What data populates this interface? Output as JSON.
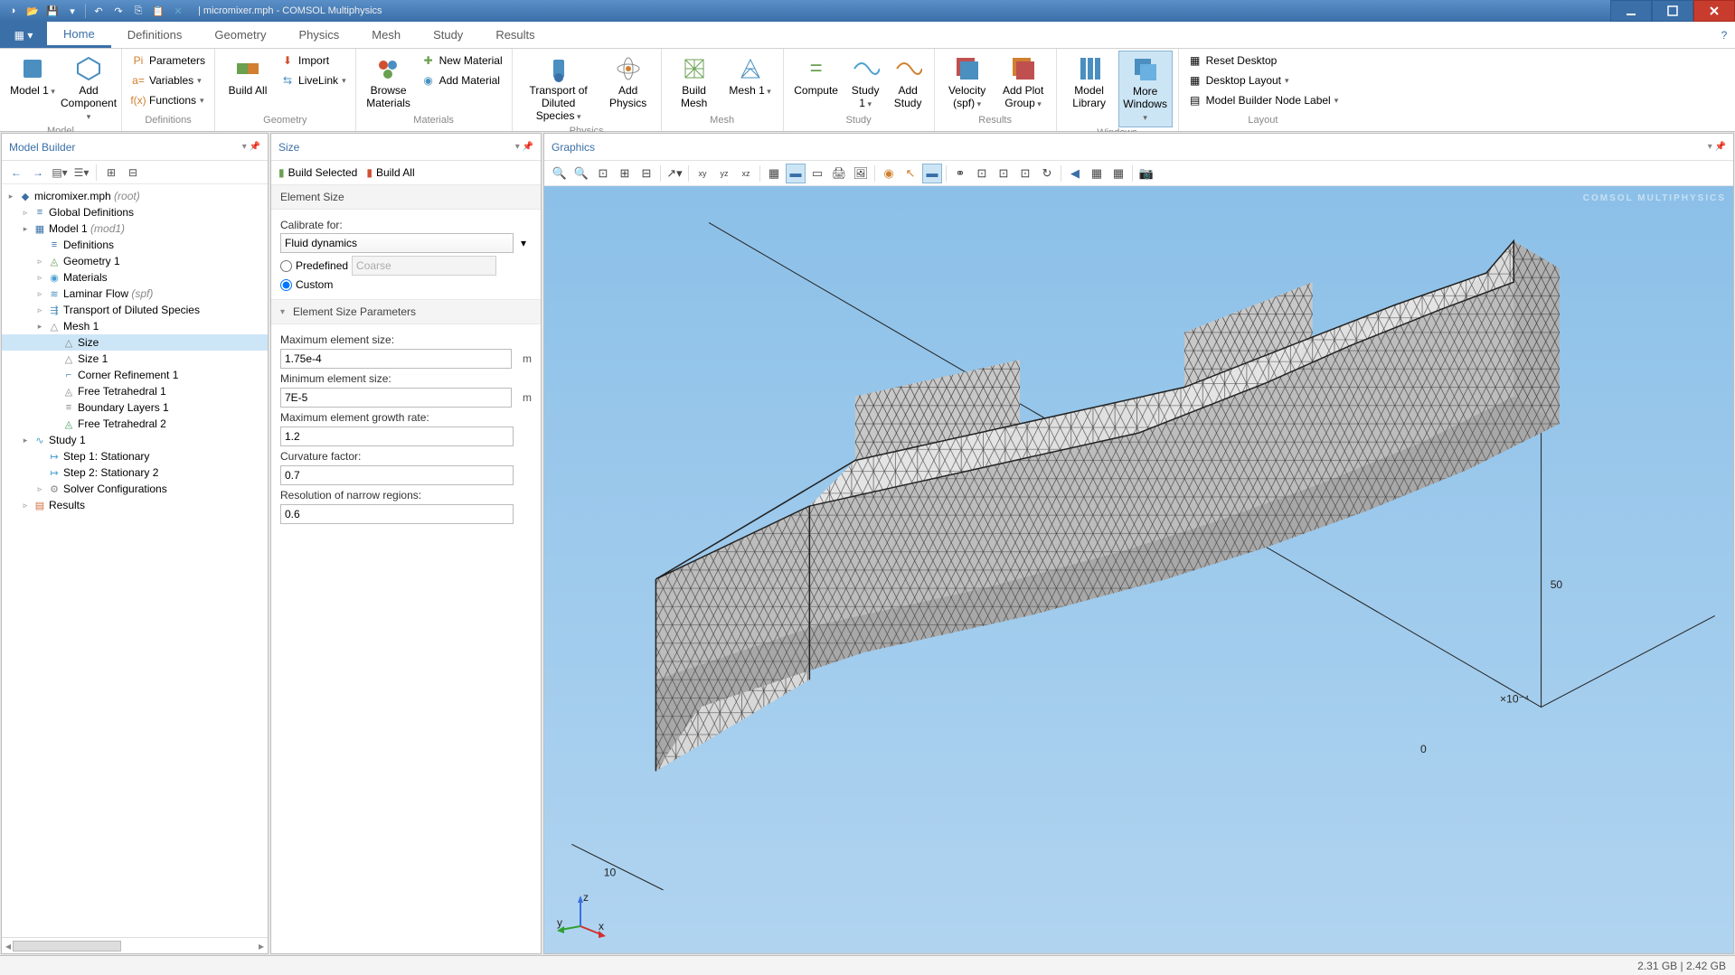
{
  "title": "| micromixer.mph - COMSOL Multiphysics",
  "ribbon": {
    "tabs": [
      "Home",
      "Definitions",
      "Geometry",
      "Physics",
      "Mesh",
      "Study",
      "Results"
    ],
    "active_tab": "Home",
    "groups": {
      "model": {
        "label": "Model",
        "model_btn": "Model\n1",
        "add_component": "Add\nComponent"
      },
      "definitions": {
        "label": "Definitions",
        "parameters": "Parameters",
        "variables": "Variables",
        "functions": "Functions"
      },
      "geometry": {
        "label": "Geometry",
        "build_all": "Build\nAll",
        "import": "Import",
        "livelink": "LiveLink"
      },
      "materials": {
        "label": "Materials",
        "browse": "Browse\nMaterials",
        "new": "New Material",
        "add": "Add Material"
      },
      "physics": {
        "label": "Physics",
        "transport": "Transport of\nDiluted Species",
        "add": "Add\nPhysics"
      },
      "mesh": {
        "label": "Mesh",
        "build": "Build\nMesh",
        "mesh": "Mesh\n1"
      },
      "study": {
        "label": "Study",
        "compute": "Compute",
        "study": "Study\n1",
        "add": "Add\nStudy"
      },
      "results": {
        "label": "Results",
        "velocity": "Velocity\n(spf)",
        "add_plot": "Add Plot\nGroup"
      },
      "windows": {
        "label": "Windows",
        "model_library": "Model\nLibrary",
        "more": "More\nWindows"
      },
      "layout": {
        "label": "Layout",
        "reset": "Reset Desktop",
        "desktop": "Desktop Layout",
        "node_label": "Model Builder Node Label"
      }
    }
  },
  "model_builder": {
    "title": "Model Builder",
    "tree": [
      {
        "depth": 0,
        "tw": "▸",
        "icon": "◆",
        "color": "#3a6fa8",
        "label": "micromixer.mph (root)",
        "italic_suffix": " (root)",
        "base": "micromixer.mph"
      },
      {
        "depth": 1,
        "tw": "▹",
        "icon": "≡",
        "color": "#3a6fa8",
        "label": "Global Definitions"
      },
      {
        "depth": 1,
        "tw": "▸",
        "icon": "▦",
        "color": "#3a6fa8",
        "label": "Model 1",
        "italic_suffix": " (mod1)"
      },
      {
        "depth": 2,
        "tw": "",
        "icon": "≡",
        "color": "#3a6fa8",
        "label": "Definitions"
      },
      {
        "depth": 2,
        "tw": "▹",
        "icon": "◬",
        "color": "#6a9a5a",
        "label": "Geometry 1"
      },
      {
        "depth": 2,
        "tw": "▹",
        "icon": "◉",
        "color": "#4aa0d0",
        "label": "Materials"
      },
      {
        "depth": 2,
        "tw": "▹",
        "icon": "≋",
        "color": "#4a8fc0",
        "label": "Laminar Flow",
        "italic_suffix": " (spf)"
      },
      {
        "depth": 2,
        "tw": "▹",
        "icon": "⇶",
        "color": "#4a8fc0",
        "label": "Transport of Diluted Species"
      },
      {
        "depth": 2,
        "tw": "▸",
        "icon": "△",
        "color": "#888",
        "label": "Mesh 1"
      },
      {
        "depth": 3,
        "tw": "",
        "icon": "△",
        "color": "#888",
        "label": "Size",
        "selected": true
      },
      {
        "depth": 3,
        "tw": "",
        "icon": "△",
        "color": "#888",
        "label": "Size 1"
      },
      {
        "depth": 3,
        "tw": "",
        "icon": "⌐",
        "color": "#4a8fc0",
        "label": "Corner Refinement 1"
      },
      {
        "depth": 3,
        "tw": "",
        "icon": "◬",
        "color": "#888",
        "label": "Free Tetrahedral 1"
      },
      {
        "depth": 3,
        "tw": "",
        "icon": "≡",
        "color": "#888",
        "label": "Boundary Layers 1"
      },
      {
        "depth": 3,
        "tw": "",
        "icon": "◬",
        "color": "#4aa060",
        "label": "Free Tetrahedral 2"
      },
      {
        "depth": 1,
        "tw": "▸",
        "icon": "∿",
        "color": "#4aa0d0",
        "label": "Study 1"
      },
      {
        "depth": 2,
        "tw": "",
        "icon": "↦",
        "color": "#4aa0d0",
        "label": "Step 1: Stationary"
      },
      {
        "depth": 2,
        "tw": "",
        "icon": "↦",
        "color": "#4aa0d0",
        "label": "Step 2: Stationary 2"
      },
      {
        "depth": 2,
        "tw": "▹",
        "icon": "⚙",
        "color": "#888",
        "label": "Solver Configurations"
      },
      {
        "depth": 1,
        "tw": "▹",
        "icon": "▤",
        "color": "#d07040",
        "label": "Results"
      }
    ]
  },
  "settings": {
    "title": "Size",
    "build_selected": "Build Selected",
    "build_all": "Build All",
    "section_element_size": "Element Size",
    "calibrate_for_label": "Calibrate for:",
    "calibrate_for_value": "Fluid dynamics",
    "predefined_label": "Predefined",
    "predefined_value": "Coarse",
    "custom_label": "Custom",
    "section_params": "Element Size Parameters",
    "max_size_label": "Maximum element size:",
    "max_size_value": "1.75e-4",
    "max_size_unit": "m",
    "min_size_label": "Minimum element size:",
    "min_size_value": "7E-5",
    "min_size_unit": "m",
    "growth_label": "Maximum element growth rate:",
    "growth_value": "1.2",
    "curvature_label": "Curvature factor:",
    "curvature_value": "0.7",
    "narrow_label": "Resolution of narrow regions:",
    "narrow_value": "0.6"
  },
  "graphics": {
    "title": "Graphics",
    "axis": {
      "label_50": "50",
      "label_0": "0",
      "scale": "×10⁻⁴",
      "label_10": "10",
      "x": "x",
      "y": "y",
      "z": "z"
    },
    "watermark": "COMSOL\nMULTIPHYSICS"
  },
  "statusbar": {
    "memory": "2.31 GB | 2.42 GB"
  }
}
